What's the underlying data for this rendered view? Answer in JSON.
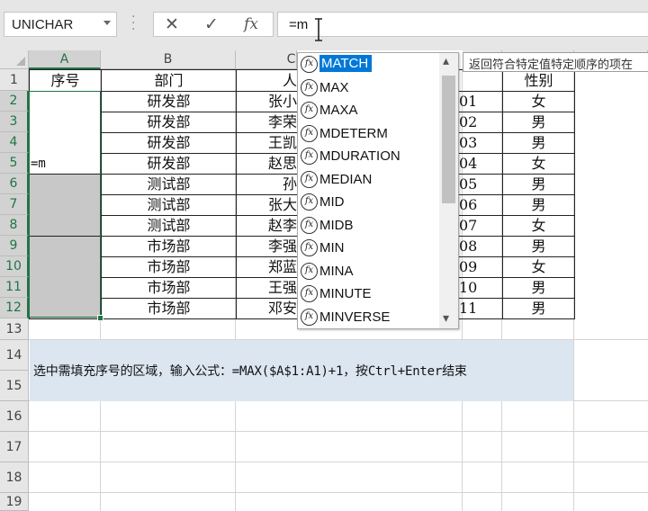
{
  "name_box": {
    "value": "UNICHAR"
  },
  "formula_bar": {
    "cancel_glyph": "✕",
    "enter_glyph": "✓",
    "fx_glyph": "fx",
    "value": "=m"
  },
  "columns": [
    "A",
    "B",
    "C"
  ],
  "rows": [
    "1",
    "2",
    "3",
    "4",
    "5",
    "6",
    "7",
    "8",
    "9",
    "10",
    "11",
    "12",
    "13",
    "14",
    "15",
    "16",
    "17",
    "18",
    "19"
  ],
  "table": {
    "headers": {
      "a": "序号",
      "b": "部门",
      "c": "人",
      "f": "性别"
    },
    "a5": "=m",
    "rows": [
      {
        "dept": "研发部",
        "name": "张小",
        "id": "01",
        "gender": "女"
      },
      {
        "dept": "研发部",
        "name": "李荣",
        "id": "02",
        "gender": "男"
      },
      {
        "dept": "研发部",
        "name": "王凯",
        "id": "03",
        "gender": "男"
      },
      {
        "dept": "研发部",
        "name": "赵思",
        "id": "04",
        "gender": "女"
      },
      {
        "dept": "测试部",
        "name": "孙",
        "id": "05",
        "gender": "男"
      },
      {
        "dept": "测试部",
        "name": "张大",
        "id": "06",
        "gender": "男"
      },
      {
        "dept": "测试部",
        "name": "赵李",
        "id": "07",
        "gender": "女"
      },
      {
        "dept": "市场部",
        "name": "李强",
        "id": "08",
        "gender": "男"
      },
      {
        "dept": "市场部",
        "name": "郑蓝",
        "id": "09",
        "gender": "女"
      },
      {
        "dept": "市场部",
        "name": "王强",
        "id": "10",
        "gender": "男"
      },
      {
        "dept": "市场部",
        "name": "邓安",
        "id": "11",
        "gender": "男"
      }
    ]
  },
  "note": "选中需填充序号的区域，输入公式：=MAX($A$1:A1)+1，按Ctrl+Enter结束",
  "autocomplete": {
    "items": [
      "MATCH",
      "MAX",
      "MAXA",
      "MDETERM",
      "MDURATION",
      "MEDIAN",
      "MID",
      "MIDB",
      "MIN",
      "MINA",
      "MINUTE",
      "MINVERSE"
    ],
    "selected": "MATCH",
    "icon_glyph": "fx",
    "scroll_up_glyph": "▴",
    "scroll_down_glyph": "▾"
  },
  "tooltip": "返回符合特定值特定顺序的项在",
  "colors": {
    "accent": "#217346",
    "highlight": "#0078d7",
    "note_bg": "#dce6f1"
  }
}
